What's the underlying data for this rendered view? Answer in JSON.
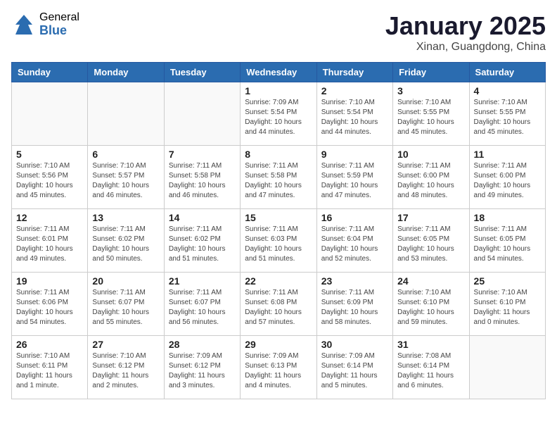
{
  "header": {
    "logo_general": "General",
    "logo_blue": "Blue",
    "title": "January 2025",
    "location": "Xinan, Guangdong, China"
  },
  "days_of_week": [
    "Sunday",
    "Monday",
    "Tuesday",
    "Wednesday",
    "Thursday",
    "Friday",
    "Saturday"
  ],
  "weeks": [
    [
      {
        "day": "",
        "info": ""
      },
      {
        "day": "",
        "info": ""
      },
      {
        "day": "",
        "info": ""
      },
      {
        "day": "1",
        "info": "Sunrise: 7:09 AM\nSunset: 5:54 PM\nDaylight: 10 hours\nand 44 minutes."
      },
      {
        "day": "2",
        "info": "Sunrise: 7:10 AM\nSunset: 5:54 PM\nDaylight: 10 hours\nand 44 minutes."
      },
      {
        "day": "3",
        "info": "Sunrise: 7:10 AM\nSunset: 5:55 PM\nDaylight: 10 hours\nand 45 minutes."
      },
      {
        "day": "4",
        "info": "Sunrise: 7:10 AM\nSunset: 5:55 PM\nDaylight: 10 hours\nand 45 minutes."
      }
    ],
    [
      {
        "day": "5",
        "info": "Sunrise: 7:10 AM\nSunset: 5:56 PM\nDaylight: 10 hours\nand 45 minutes."
      },
      {
        "day": "6",
        "info": "Sunrise: 7:10 AM\nSunset: 5:57 PM\nDaylight: 10 hours\nand 46 minutes."
      },
      {
        "day": "7",
        "info": "Sunrise: 7:11 AM\nSunset: 5:58 PM\nDaylight: 10 hours\nand 46 minutes."
      },
      {
        "day": "8",
        "info": "Sunrise: 7:11 AM\nSunset: 5:58 PM\nDaylight: 10 hours\nand 47 minutes."
      },
      {
        "day": "9",
        "info": "Sunrise: 7:11 AM\nSunset: 5:59 PM\nDaylight: 10 hours\nand 47 minutes."
      },
      {
        "day": "10",
        "info": "Sunrise: 7:11 AM\nSunset: 6:00 PM\nDaylight: 10 hours\nand 48 minutes."
      },
      {
        "day": "11",
        "info": "Sunrise: 7:11 AM\nSunset: 6:00 PM\nDaylight: 10 hours\nand 49 minutes."
      }
    ],
    [
      {
        "day": "12",
        "info": "Sunrise: 7:11 AM\nSunset: 6:01 PM\nDaylight: 10 hours\nand 49 minutes."
      },
      {
        "day": "13",
        "info": "Sunrise: 7:11 AM\nSunset: 6:02 PM\nDaylight: 10 hours\nand 50 minutes."
      },
      {
        "day": "14",
        "info": "Sunrise: 7:11 AM\nSunset: 6:02 PM\nDaylight: 10 hours\nand 51 minutes."
      },
      {
        "day": "15",
        "info": "Sunrise: 7:11 AM\nSunset: 6:03 PM\nDaylight: 10 hours\nand 51 minutes."
      },
      {
        "day": "16",
        "info": "Sunrise: 7:11 AM\nSunset: 6:04 PM\nDaylight: 10 hours\nand 52 minutes."
      },
      {
        "day": "17",
        "info": "Sunrise: 7:11 AM\nSunset: 6:05 PM\nDaylight: 10 hours\nand 53 minutes."
      },
      {
        "day": "18",
        "info": "Sunrise: 7:11 AM\nSunset: 6:05 PM\nDaylight: 10 hours\nand 54 minutes."
      }
    ],
    [
      {
        "day": "19",
        "info": "Sunrise: 7:11 AM\nSunset: 6:06 PM\nDaylight: 10 hours\nand 54 minutes."
      },
      {
        "day": "20",
        "info": "Sunrise: 7:11 AM\nSunset: 6:07 PM\nDaylight: 10 hours\nand 55 minutes."
      },
      {
        "day": "21",
        "info": "Sunrise: 7:11 AM\nSunset: 6:07 PM\nDaylight: 10 hours\nand 56 minutes."
      },
      {
        "day": "22",
        "info": "Sunrise: 7:11 AM\nSunset: 6:08 PM\nDaylight: 10 hours\nand 57 minutes."
      },
      {
        "day": "23",
        "info": "Sunrise: 7:11 AM\nSunset: 6:09 PM\nDaylight: 10 hours\nand 58 minutes."
      },
      {
        "day": "24",
        "info": "Sunrise: 7:10 AM\nSunset: 6:10 PM\nDaylight: 10 hours\nand 59 minutes."
      },
      {
        "day": "25",
        "info": "Sunrise: 7:10 AM\nSunset: 6:10 PM\nDaylight: 11 hours\nand 0 minutes."
      }
    ],
    [
      {
        "day": "26",
        "info": "Sunrise: 7:10 AM\nSunset: 6:11 PM\nDaylight: 11 hours\nand 1 minute."
      },
      {
        "day": "27",
        "info": "Sunrise: 7:10 AM\nSunset: 6:12 PM\nDaylight: 11 hours\nand 2 minutes."
      },
      {
        "day": "28",
        "info": "Sunrise: 7:09 AM\nSunset: 6:12 PM\nDaylight: 11 hours\nand 3 minutes."
      },
      {
        "day": "29",
        "info": "Sunrise: 7:09 AM\nSunset: 6:13 PM\nDaylight: 11 hours\nand 4 minutes."
      },
      {
        "day": "30",
        "info": "Sunrise: 7:09 AM\nSunset: 6:14 PM\nDaylight: 11 hours\nand 5 minutes."
      },
      {
        "day": "31",
        "info": "Sunrise: 7:08 AM\nSunset: 6:14 PM\nDaylight: 11 hours\nand 6 minutes."
      },
      {
        "day": "",
        "info": ""
      }
    ]
  ]
}
